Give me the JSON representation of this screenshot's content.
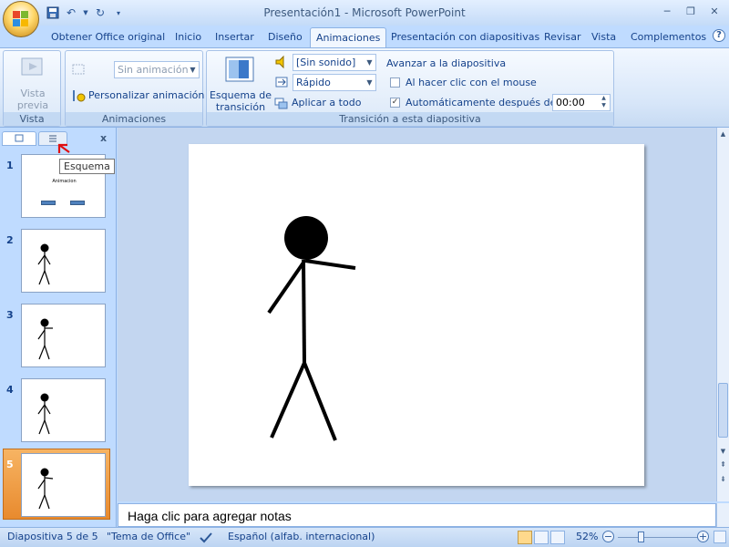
{
  "window": {
    "title": "Presentación1 - Microsoft PowerPoint"
  },
  "tabs": [
    {
      "label": "Obtener Office original",
      "active": false
    },
    {
      "label": "Inicio",
      "active": false
    },
    {
      "label": "Insertar",
      "active": false
    },
    {
      "label": "Diseño",
      "active": false
    },
    {
      "label": "Animaciones",
      "active": true
    },
    {
      "label": "Presentación con diapositivas",
      "active": false
    },
    {
      "label": "Revisar",
      "active": false
    },
    {
      "label": "Vista",
      "active": false
    },
    {
      "label": "Complementos",
      "active": false
    }
  ],
  "ribbon": {
    "preview": {
      "button_label_line1": "Vista",
      "button_label_line2": "previa",
      "group_label": "Vista previa"
    },
    "animations": {
      "animate_value": "Sin animación",
      "custom_label": "Personalizar animación",
      "group_label": "Animaciones"
    },
    "transition": {
      "scheme_line1": "Esquema de",
      "scheme_line2": "transición",
      "sound_value": "[Sin sonido]",
      "speed_value": "Rápido",
      "apply_all_label": "Aplicar a todo",
      "advance_heading": "Avanzar a la diapositiva",
      "on_click_label": "Al hacer clic con el mouse",
      "on_click_checked": false,
      "auto_label": "Automáticamente después de:",
      "auto_checked": true,
      "auto_time": "00:00",
      "group_label": "Transición a esta diapositiva"
    }
  },
  "slides_panel": {
    "tooltip": "Esquema",
    "slides": [
      {
        "number": "1",
        "content": "title",
        "title_text": "Animacion"
      },
      {
        "number": "2",
        "content": "stick-figure-arms-down"
      },
      {
        "number": "3",
        "content": "stick-figure-arm-raised"
      },
      {
        "number": "4",
        "content": "stick-figure-arms-down"
      },
      {
        "number": "5",
        "content": "stick-figure-arm-raised",
        "selected": true
      }
    ]
  },
  "notes": {
    "placeholder": "Haga clic para agregar notas"
  },
  "statusbar": {
    "slide_info": "Diapositiva 5 de 5",
    "theme": "\"Tema de Office\"",
    "language": "Español (alfab. internacional)",
    "zoom": "52%"
  },
  "colors": {
    "selected_slide": "#e88a2e",
    "ribbon_bg": "#d7e6f9",
    "accent": "#15428b"
  }
}
